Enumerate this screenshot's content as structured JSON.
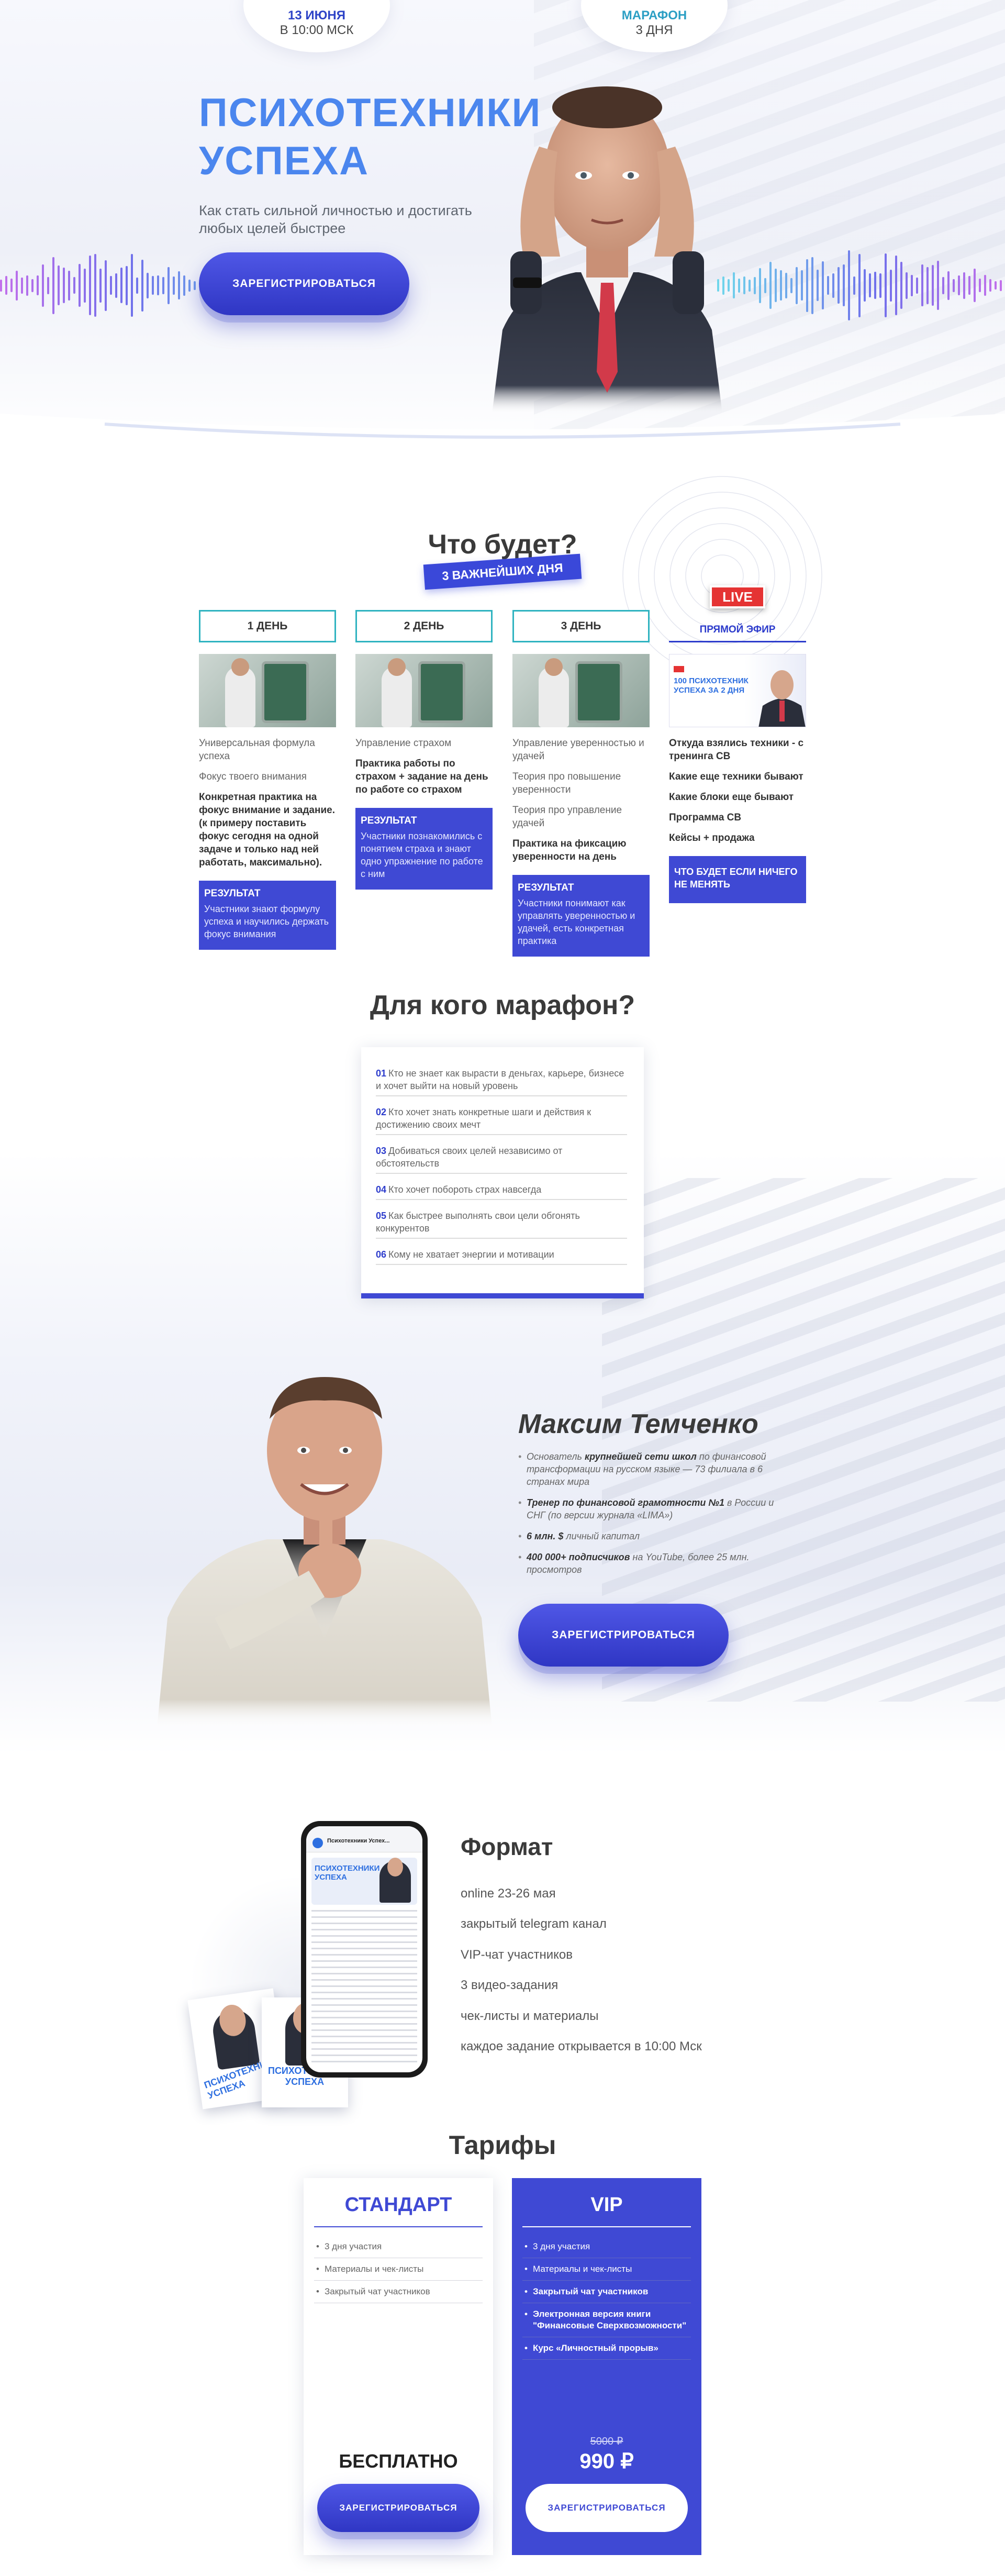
{
  "hero": {
    "date_main": "13 июня",
    "date_sub": "в 10:00 МСК",
    "marathon_main": "МАРАФОН",
    "marathon_sub": "3 дня",
    "title_line1": "ПСИХОТЕХНИКИ",
    "title_line2": "УСПЕХА",
    "subtitle": "Как стать сильной личностью и достигать любых целей быстрее",
    "cta": "ЗАРЕГИСТРИРОВАТЬСЯ"
  },
  "program": {
    "title": "Что будет?",
    "tag": "3 ВАЖНЕЙШИХ ДНЯ",
    "days": [
      {
        "label": "1 ДЕНЬ",
        "items": [
          "Универсальная формула успеха",
          "Фокус твоего внимания"
        ],
        "bold": "Конкретная практика на фокус внимание и задание. (к примеру поставить фокус сегодня на одной задаче и только над ней работать, максимально).",
        "result_title": "РЕЗУЛЬТАТ",
        "result_text": "Участники знают формулу успеха и научились держать фокус внимания"
      },
      {
        "label": "2 ДЕНЬ",
        "items": [
          "Управление страхом"
        ],
        "bold": "Практика работы по страхом + задание на день по работе со страхом",
        "result_title": "РЕЗУЛЬТАТ",
        "result_text": "Участники познакомились с понятием страха и знают одно упражнение по работе с ним"
      },
      {
        "label": "3 ДЕНЬ",
        "items": [
          "Управление уверенностью и удачей",
          "Теория про повышение уверенности",
          "Теория про управление удачей"
        ],
        "bold": "Практика на фиксацию уверенности на день",
        "result_title": "РЕЗУЛЬТАТ",
        "result_text": "Участники понимают как управлять уверенностью и удачей, есть конкретная практика"
      }
    ],
    "live": {
      "badge": "LIVE",
      "label": "ПРЯМОЙ ЭФИР",
      "thumb_text": "100 ПСИХОТЕХНИК УСПЕХА ЗА 2 ДНЯ",
      "items": [
        "Откуда взялись техники - с тренинга СВ",
        "Какие еще техники бывают",
        "Какие блоки еще бывают",
        "Программа СВ",
        "Кейсы + продажа"
      ],
      "result_text": "ЧТО БУДЕТ ЕСЛИ НИЧЕГО НЕ МЕНЯТЬ"
    }
  },
  "audience": {
    "title": "Для кого марафон?",
    "items": [
      {
        "num": "01",
        "text": "Кто не знает как вырасти в деньгах, карьере, бизнесе и хочет выйти на новый уровень"
      },
      {
        "num": "02",
        "text": "Кто хочет знать конкретные шаги и действия к достижению своих мечт"
      },
      {
        "num": "03",
        "text": "Добиваться своих целей независимо от обстоятельств"
      },
      {
        "num": "04",
        "text": "Кто хочет побороть страх навсегда"
      },
      {
        "num": "05",
        "text": "Как быстрее выполнять свои цели обгонять конкурентов"
      },
      {
        "num": "06",
        "text": "Кому не хватает энергии и мотивации"
      }
    ]
  },
  "speaker": {
    "name": "Максим Темченко",
    "facts": [
      {
        "pre": "Основатель ",
        "bold": "крупнейшей сети школ",
        "post": " по финансовой трансформации на русском языке — 73 филиала в 6 странах мира"
      },
      {
        "pre": "",
        "bold": "Тренер по финансовой грамотности №1",
        "post": " в России и СНГ (по версии журнала «LIMA»)"
      },
      {
        "pre": "",
        "bold": "6 млн. $",
        "post": " личный капитал"
      },
      {
        "pre": "",
        "bold": "400 000+ подписчиков",
        "post": " на YouTube, более 25 млн. просмотров"
      }
    ],
    "cta": "ЗАРЕГИСТРИРОВАТЬСЯ"
  },
  "format": {
    "title": "Формат",
    "items": [
      "online 23-26 мая",
      "закрытый telegram канал",
      "VIP-чат участников",
      "3 видео-задания",
      "чек-листы и материалы",
      "каждое задание открывается в 10:00 Мск"
    ],
    "phone_header": "Психотехники Успех...",
    "phone_title": "ПСИХОТЕХНИКИ УСПЕХА",
    "card_title": "ПСИХОТЕХНИКИ УСПЕХА"
  },
  "tariffs": {
    "title": "Тарифы",
    "standard": {
      "name": "СТАНДАРТ",
      "items": [
        "3 дня участия",
        "Материалы и чек-листы",
        "Закрытый чат участников"
      ],
      "price": "БЕСПЛАТНО",
      "cta": "ЗАРЕГИСТРИРОВАТЬСЯ"
    },
    "vip": {
      "name": "VIP",
      "items": [
        "3 дня участия",
        "Материалы и чек-листы",
        "Закрытый чат участников",
        "Электронная версия книги \"Финансовые Сверхвозможности\"",
        "Курс «Личностный прорыв»"
      ],
      "old_price": "5000 ₽",
      "price": "990 ₽",
      "cta": "ЗАРЕГИСТРИРОВАТЬСЯ"
    }
  },
  "colors": {
    "accent": "#3f49d4",
    "title_blue": "#4b86ee",
    "teal": "#2fb3c0",
    "live_red": "#e53333"
  }
}
